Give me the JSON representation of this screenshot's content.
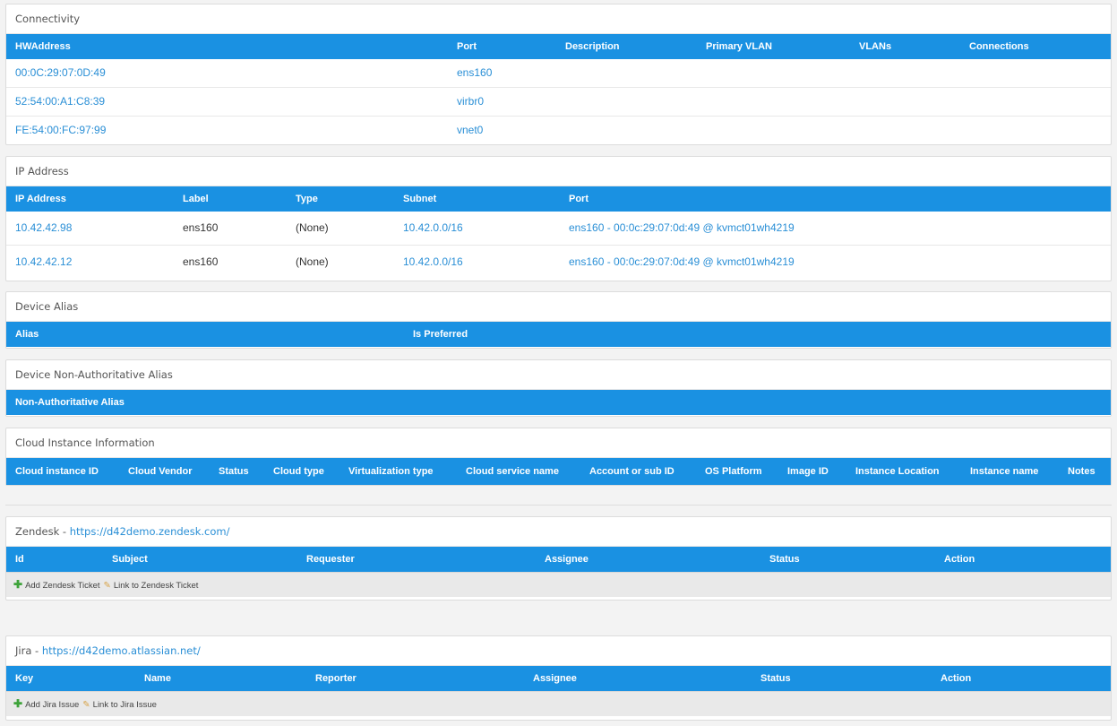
{
  "connectivity": {
    "title": "Connectivity",
    "headers": [
      "HWAddress",
      "Port",
      "Description",
      "Primary VLAN",
      "VLANs",
      "Connections"
    ],
    "rows": [
      {
        "hw": "00:0C:29:07:0D:49",
        "port": "ens160"
      },
      {
        "hw": "52:54:00:A1:C8:39",
        "port": "virbr0"
      },
      {
        "hw": "FE:54:00:FC:97:99",
        "port": "vnet0"
      }
    ]
  },
  "ip": {
    "title": "IP Address",
    "headers": [
      "IP Address",
      "Label",
      "Type",
      "Subnet",
      "Port"
    ],
    "rows": [
      {
        "ip": "10.42.42.98",
        "label": "ens160",
        "type": "(None)",
        "subnet": "10.42.0.0/16",
        "port": "ens160 - 00:0c:29:07:0d:49 @ kvmct01wh4219"
      },
      {
        "ip": "10.42.42.12",
        "label": "ens160",
        "type": "(None)",
        "subnet": "10.42.0.0/16",
        "port": "ens160 - 00:0c:29:07:0d:49 @ kvmct01wh4219"
      }
    ]
  },
  "alias": {
    "title": "Device Alias",
    "headers": [
      "Alias",
      "Is Preferred"
    ]
  },
  "nonauth": {
    "title": "Device Non-Authoritative Alias",
    "headers": [
      "Non-Authoritative Alias"
    ]
  },
  "cloud": {
    "title": "Cloud Instance Information",
    "headers": [
      "Cloud instance ID",
      "Cloud Vendor",
      "Status",
      "Cloud type",
      "Virtualization type",
      "Cloud service name",
      "Account or sub ID",
      "OS Platform",
      "Image ID",
      "Instance Location",
      "Instance name",
      "Notes"
    ]
  },
  "zendesk": {
    "title_prefix": "Zendesk - ",
    "url": "https://d42demo.zendesk.com/",
    "headers": [
      "Id",
      "Subject",
      "Requester",
      "Assignee",
      "Status",
      "Action"
    ],
    "add_label": "Add Zendesk Ticket",
    "link_label": "Link to Zendesk Ticket"
  },
  "jira": {
    "title_prefix": "Jira - ",
    "url": "https://d42demo.atlassian.net/",
    "headers": [
      "Key",
      "Name",
      "Reporter",
      "Assignee",
      "Status",
      "Action"
    ],
    "add_label": "Add Jira Issue",
    "link_label": "Link to Jira Issue"
  },
  "icons": {
    "add": "plus-icon",
    "link": "pencil-icon"
  },
  "colors": {
    "header_bg": "#1a91e2",
    "link": "#2a8fd6",
    "add_icon": "#3ea33a"
  }
}
